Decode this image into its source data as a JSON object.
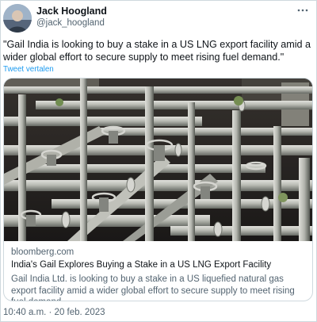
{
  "author": {
    "display_name": "Jack Hoogland",
    "handle": "@jack_hoogland",
    "avatar_icon": "user-avatar-photo"
  },
  "menu": {
    "icon": "more-options-icon"
  },
  "tweet": {
    "text": "\"Gail India is looking to buy a stake in a US LNG export facility amid a wider global effort to secure supply to meet rising fuel demand.\"",
    "translate_label": "Tweet vertalen",
    "timestamp": "10:40 a.m. · 20 feb. 2023"
  },
  "card": {
    "image_subject": "industrial-pipes-photo",
    "domain": "bloomberg.com",
    "title": "India's Gail Explores Buying a Stake in a US LNG Export Facility",
    "description": "Gail India Ltd. is looking to buy a stake in a US liquefied natural gas export facility amid a wider global effort to secure supply to meet rising fuel demand."
  },
  "colors": {
    "link": "#1d9bf0",
    "secondary_text": "#536471",
    "border": "#cfd9de",
    "primary_text": "#0f1419"
  }
}
